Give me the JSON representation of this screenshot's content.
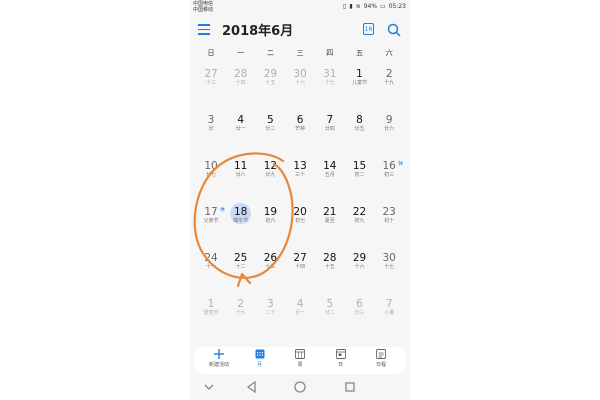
{
  "status_bar": {
    "carrier_line1": "中国电信",
    "carrier_line2": "中国移动",
    "battery": "94%",
    "time": "05:23"
  },
  "header": {
    "title": "2018年6月",
    "today_icon_text": "16"
  },
  "weekdays": [
    "日",
    "一",
    "二",
    "三",
    "四",
    "五",
    "六"
  ],
  "weeks": [
    [
      {
        "num": "27",
        "lunar": "十三",
        "other": true
      },
      {
        "num": "28",
        "lunar": "十四",
        "other": true
      },
      {
        "num": "29",
        "lunar": "十五",
        "other": true
      },
      {
        "num": "30",
        "lunar": "十六",
        "other": true
      },
      {
        "num": "31",
        "lunar": "十七",
        "other": true
      },
      {
        "num": "1",
        "lunar": "儿童节"
      },
      {
        "num": "2",
        "lunar": "十九"
      }
    ],
    [
      {
        "num": "3",
        "lunar": "廿"
      },
      {
        "num": "4",
        "lunar": "廿一"
      },
      {
        "num": "5",
        "lunar": "廿二"
      },
      {
        "num": "6",
        "lunar": "芒种"
      },
      {
        "num": "7",
        "lunar": "廿四"
      },
      {
        "num": "8",
        "lunar": "廿五"
      },
      {
        "num": "9",
        "lunar": "廿六"
      }
    ],
    [
      {
        "num": "10",
        "lunar": "廿七"
      },
      {
        "num": "11",
        "lunar": "廿八"
      },
      {
        "num": "12",
        "lunar": "廿九"
      },
      {
        "num": "13",
        "lunar": "三十"
      },
      {
        "num": "14",
        "lunar": "五月"
      },
      {
        "num": "15",
        "lunar": "初二"
      },
      {
        "num": "16",
        "lunar": "初三",
        "badge": "休"
      }
    ],
    [
      {
        "num": "17",
        "lunar": "父亲节",
        "badge": "休"
      },
      {
        "num": "18",
        "lunar": "端午节",
        "today": true
      },
      {
        "num": "19",
        "lunar": "初六"
      },
      {
        "num": "20",
        "lunar": "初七"
      },
      {
        "num": "21",
        "lunar": "夏至"
      },
      {
        "num": "22",
        "lunar": "初九"
      },
      {
        "num": "23",
        "lunar": "初十"
      }
    ],
    [
      {
        "num": "24",
        "lunar": "十一"
      },
      {
        "num": "25",
        "lunar": "十二"
      },
      {
        "num": "26",
        "lunar": "十三"
      },
      {
        "num": "27",
        "lunar": "十四"
      },
      {
        "num": "28",
        "lunar": "十五"
      },
      {
        "num": "29",
        "lunar": "十六"
      },
      {
        "num": "30",
        "lunar": "十七"
      }
    ],
    [
      {
        "num": "1",
        "lunar": "建党节",
        "other": true
      },
      {
        "num": "2",
        "lunar": "十九",
        "other": true
      },
      {
        "num": "3",
        "lunar": "二十",
        "other": true
      },
      {
        "num": "4",
        "lunar": "廿一",
        "other": true
      },
      {
        "num": "5",
        "lunar": "廿二",
        "other": true
      },
      {
        "num": "6",
        "lunar": "廿三",
        "other": true
      },
      {
        "num": "7",
        "lunar": "小暑",
        "other": true
      }
    ]
  ],
  "bottom_nav": [
    {
      "label": "新建活动",
      "icon": "plus-icon"
    },
    {
      "label": "月",
      "icon": "month-view-icon",
      "active": true
    },
    {
      "label": "周",
      "icon": "week-view-icon"
    },
    {
      "label": "日",
      "icon": "day-view-icon"
    },
    {
      "label": "日程",
      "icon": "agenda-icon"
    }
  ],
  "colors": {
    "accent": "#1f7fe0",
    "annotation": "#e8893a",
    "today_highlight": "#c7dbf5"
  }
}
